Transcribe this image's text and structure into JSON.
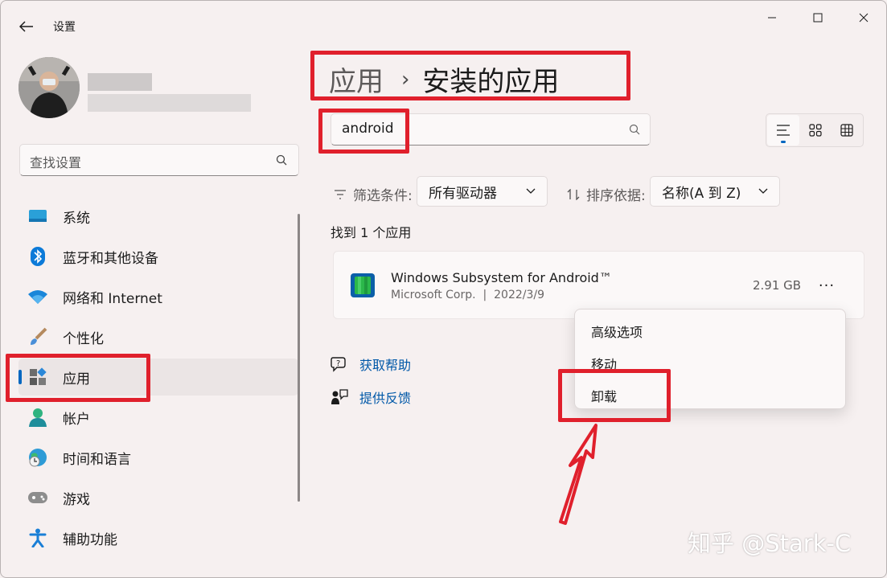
{
  "window": {
    "title": "设置",
    "icons": {
      "back": "arrow-left-icon",
      "minimize": "minimize-icon",
      "maximize": "maximize-icon",
      "close": "close-icon"
    }
  },
  "sidebar": {
    "search_placeholder": "查找设置",
    "items": [
      {
        "label": "系统",
        "icon": "monitor-icon",
        "active": false
      },
      {
        "label": "蓝牙和其他设备",
        "icon": "bluetooth-icon",
        "active": false
      },
      {
        "label": "网络和 Internet",
        "icon": "wifi-icon",
        "active": false
      },
      {
        "label": "个性化",
        "icon": "brush-icon",
        "active": false
      },
      {
        "label": "应用",
        "icon": "apps-icon",
        "active": true
      },
      {
        "label": "帐户",
        "icon": "user-icon",
        "active": false
      },
      {
        "label": "时间和语言",
        "icon": "globe-clock-icon",
        "active": false
      },
      {
        "label": "游戏",
        "icon": "gamepad-icon",
        "active": false
      },
      {
        "label": "辅助功能",
        "icon": "accessibility-icon",
        "active": false
      }
    ]
  },
  "main": {
    "breadcrumb": {
      "parent": "应用",
      "current": "安装的应用"
    },
    "search": {
      "value": "android"
    },
    "filter": {
      "label": "筛选条件:",
      "value": "所有驱动器"
    },
    "sort": {
      "label": "排序依据:",
      "value": "名称(A 到 Z)"
    },
    "found_text": "找到 1 个应用",
    "app": {
      "name": "Windows Subsystem for Android™",
      "publisher": "Microsoft Corp.",
      "separator": "|",
      "date": "2022/3/9",
      "size": "2.91 GB",
      "more": "···"
    },
    "menu": {
      "items": [
        "高级选项",
        "移动",
        "卸载"
      ]
    },
    "links": [
      {
        "label": "获取帮助",
        "icon": "help-chat-icon"
      },
      {
        "label": "提供反馈",
        "icon": "feedback-icon"
      }
    ]
  },
  "watermark": "知乎 @Stark-C",
  "colors": {
    "accent": "#0067c0",
    "annotation": "#e0202c",
    "link": "#0058a8"
  }
}
